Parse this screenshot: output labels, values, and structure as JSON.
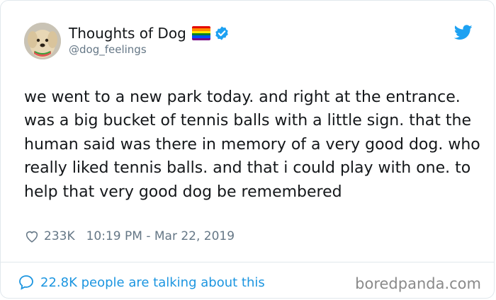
{
  "author": {
    "display_name": "Thoughts of Dog",
    "handle": "@dog_feelings",
    "avatar_icon": "dog-avatar-icon",
    "badges": [
      "rainbow-flag-icon",
      "verified-badge-icon"
    ]
  },
  "tweet": {
    "text": "we went to a new park today. and right at the entrance. was a big bucket of tennis balls with a little sign. that the human said was there in memory of a very good dog. who really liked tennis balls. and that i could play with one. to help that very good dog be remembered",
    "likes": "233K",
    "timestamp": "10:19 PM - Mar 22, 2019"
  },
  "footer": {
    "conversation_label": "22.8K people are talking about this"
  },
  "watermark": "boredpanda.com",
  "colors": {
    "twitter_blue": "#1da1f2",
    "link_blue": "#1b95e0",
    "muted_gray": "#657786",
    "text_dark": "#14171a"
  }
}
